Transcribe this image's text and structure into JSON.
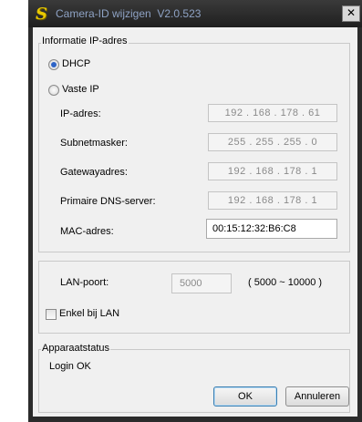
{
  "window": {
    "title": "Camera-ID wijzigen",
    "version": "V2.0.523",
    "close_label": "✕"
  },
  "ip_group": {
    "legend": "Informatie IP-adres",
    "dhcp_label": "DHCP",
    "dhcp_selected": true,
    "static_label": "Vaste IP",
    "static_selected": false,
    "fields": {
      "ip_label": "IP-adres:",
      "ip_value": "192 . 168 . 178 . 61",
      "subnet_label": "Subnetmasker:",
      "subnet_value": "255 . 255 . 255 . 0",
      "gateway_label": "Gatewayadres:",
      "gateway_value": "192 . 168 . 178 . 1",
      "dns_label": "Primaire DNS-server:",
      "dns_value": "192 . 168 . 178 . 1",
      "mac_label": "MAC-adres:",
      "mac_value": "00:15:12:32:B6:C8"
    }
  },
  "lan_group": {
    "port_label": "LAN-poort:",
    "port_value": "5000",
    "port_range": "( 5000 ~ 10000 )",
    "lan_only_label": "Enkel bij LAN",
    "lan_only_checked": false
  },
  "status_group": {
    "legend": "Apparaatstatus",
    "status_text": "Login OK"
  },
  "buttons": {
    "ok_label": "OK",
    "cancel_label": "Annuleren"
  },
  "colors": {
    "title_text": "#8ea2c4",
    "app_icon": "#e8c800",
    "radio_dot": "#2d63c6"
  }
}
